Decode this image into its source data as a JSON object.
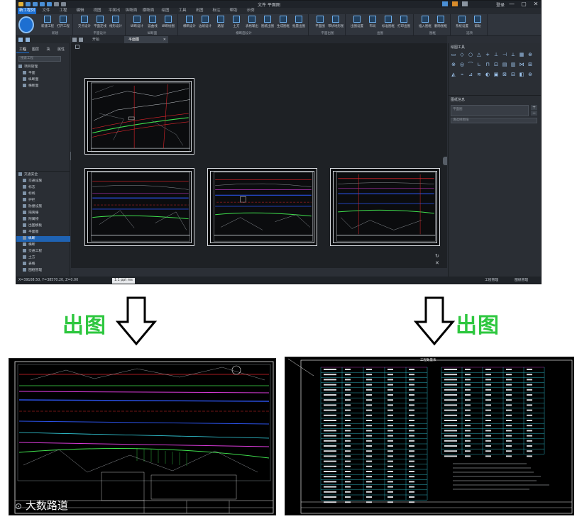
{
  "app": {
    "title": "文件   平面图",
    "menu_tabs": [
      "新工程列表",
      "文件",
      "工程",
      "编辑",
      "视图",
      "平面出图",
      "纵断面",
      "横断面",
      "绘图",
      "工具",
      "出图",
      "标注",
      "帮助",
      "示例"
    ],
    "active_menu_tab": 0,
    "window_buttons": [
      "—",
      "▢",
      "✕"
    ],
    "user_label": "登录",
    "ribbon_groups": [
      {
        "label": "新建",
        "buttons": [
          "新建工程",
          "打开工程"
        ]
      },
      {
        "label": "平面设计",
        "buttons": [
          "交点设计",
          "平面定线",
          "线形设计"
        ]
      },
      {
        "label": "纵断面",
        "buttons": [
          "纵断设计",
          "竖曲线",
          "纵断绘图"
        ]
      },
      {
        "label": "横断面设计",
        "buttons": [
          "横断设计",
          "边坡设计",
          "路基",
          "土方",
          "表格输出",
          "图纸出图",
          "生成图框",
          "批量出图"
        ]
      },
      {
        "label": "平面出图",
        "buttons": [
          "平面图",
          "带状地形图"
        ]
      },
      {
        "label": "出图",
        "buttons": [
          "出图设置",
          "布局",
          "标准图框",
          "打印出图"
        ]
      },
      {
        "label": "图框",
        "buttons": [
          "插入图框",
          "删除图框"
        ]
      },
      {
        "label": "选项",
        "buttons": [
          "系统设置",
          "帮助"
        ]
      }
    ]
  },
  "left_panel": {
    "tabs": [
      "工程",
      "图层",
      "块",
      "属性"
    ],
    "search_placeholder": "搜索工程",
    "tree_top": [
      "项目管理",
      "平面",
      "纵断面",
      "横断面"
    ],
    "tree_bottom": [
      "交通安全",
      "交通设施",
      "标志",
      "标线",
      "护栏",
      "防撞设施",
      "隔离栅",
      "附属物",
      "出图模板",
      "平面图",
      "纵断",
      "横断",
      "交通工程",
      "土方",
      "表格",
      "图框管理"
    ],
    "selected_tree_item": 10
  },
  "doc_tabs": [
    "开始",
    "平面图"
  ],
  "active_doc_tab": 1,
  "right_panel": {
    "tools_title": "绘图工具",
    "props_title": "图纸信息",
    "props_value": "平面图",
    "props_hint": "请选择图纸",
    "tools": [
      "▭",
      "◇",
      "○",
      "△",
      "+",
      "⊥",
      "⊣",
      "⟂",
      "▦",
      "⊕",
      "⊗",
      "◎",
      "⌒",
      "∟",
      "⊓",
      "⊡",
      "▤",
      "▥",
      "⋈",
      "⊞",
      "◭",
      "⌁",
      "⊿",
      "≋",
      "◐",
      "▣",
      "⊠",
      "⊟",
      "◧",
      "⊛"
    ]
  },
  "status": {
    "coords": "X=39108.50, Y=38570.20, Z=0.00",
    "scale_tag": "1:1 ppt ms",
    "right_items": [
      "工程管理",
      "图纸管理"
    ]
  },
  "lower": {
    "left_label": "出图",
    "right_label": "出图",
    "watermark": "大数路道",
    "table_title": "工程数量表"
  },
  "colors": {
    "accent": "#1d6fd1",
    "green_label": "#2ec73f",
    "cad_red": "#e0262b",
    "cad_green": "#3fe04d",
    "cad_blue": "#2b52e8",
    "cad_cyan": "#35d6e6",
    "cad_magenta": "#d83ad8"
  }
}
